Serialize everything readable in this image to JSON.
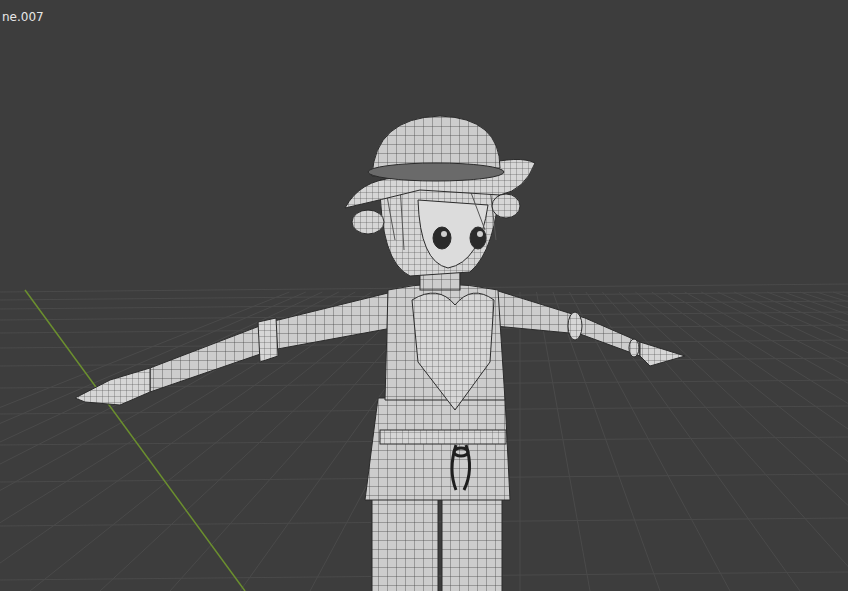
{
  "viewport": {
    "object_label": "ne.007"
  }
}
